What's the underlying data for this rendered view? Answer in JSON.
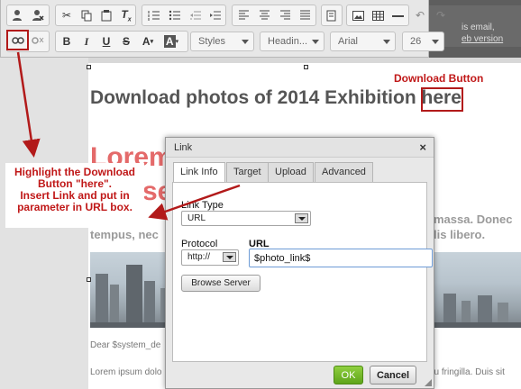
{
  "editor": {
    "email_banner": {
      "line1": "is email,",
      "line2": "eb version"
    },
    "headline": "Download photos of 2014 Exhibition here",
    "lorem_heading_line1": "Lorem",
    "lorem_heading_line2": "se",
    "body_right_1": "massa. Donec",
    "body_left_2": "tempus, nec",
    "body_right_2": "lis libero.",
    "dear_line": "Dear $system_de",
    "lorem_small_left": "Lorem ipsum dolo",
    "lorem_small_right": "eu fringilla. Duis sit"
  },
  "toolbar": {
    "row1_icons": [
      "user-icon",
      "user-remove-icon",
      "cut-icon",
      "copy-icon",
      "paste-icon",
      "clear-format-icon",
      "numbered-list-icon",
      "bulleted-list-icon",
      "outdent-icon",
      "indent-icon",
      "align-left-icon",
      "align-center-icon",
      "align-right-icon",
      "justify-icon",
      "template-icon",
      "image-icon",
      "table-icon",
      "horizontal-line-icon",
      "undo-icon",
      "redo-icon"
    ],
    "row2": {
      "bold": "B",
      "italic": "I",
      "underline": "U",
      "strike": "S",
      "text_color": "A",
      "bg_color": "A",
      "styles": "Styles",
      "heading": "Headin...",
      "font": "Arial",
      "size": "26"
    }
  },
  "dialog": {
    "title": "Link",
    "close": "×",
    "tabs": [
      "Link Info",
      "Target",
      "Upload",
      "Advanced"
    ],
    "active_tab": "Link Info",
    "link_type_label": "Link Type",
    "link_type_value": "URL",
    "protocol_label": "Protocol",
    "protocol_value": "http://",
    "url_label": "URL",
    "url_value": "$photo_link$",
    "browse_label": "Browse Server",
    "ok_label": "OK",
    "cancel_label": "Cancel"
  },
  "annotations": {
    "download_label": "Download Button",
    "callout_lines": [
      "Highlight the Download",
      "Button \"here\".",
      "Insert Link and put in",
      "parameter in URL box."
    ],
    "color": "#c01818"
  }
}
